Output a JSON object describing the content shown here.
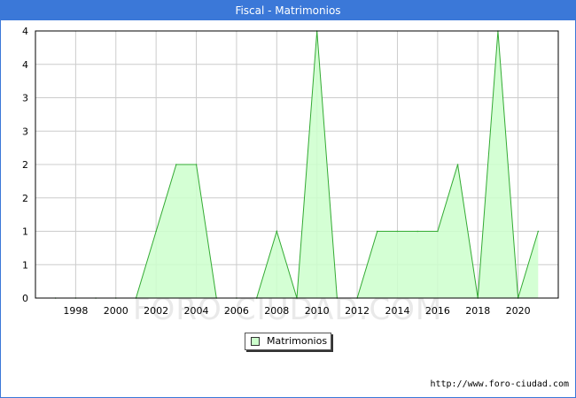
{
  "window": {
    "title": "Fiscal - Matrimonios"
  },
  "watermark": "FORO-CIUDAD.COM",
  "footer_url": "http://www.foro-ciudad.com",
  "colors": {
    "title_bar": "#3b78d8",
    "area_fill": "#ccffcc",
    "area_line": "#33aa33",
    "grid": "#cccccc"
  },
  "chart_data": {
    "type": "area",
    "title": "Fiscal - Matrimonios",
    "xlabel": "",
    "ylabel": "",
    "x": [
      1997,
      1998,
      1999,
      2000,
      2001,
      2002,
      2003,
      2004,
      2005,
      2006,
      2007,
      2008,
      2009,
      2010,
      2011,
      2012,
      2013,
      2014,
      2015,
      2016,
      2017,
      2018,
      2019,
      2020,
      2021
    ],
    "series": [
      {
        "name": "Matrimonios",
        "values": [
          0,
          0,
          0,
          0,
          0,
          1,
          2,
          2,
          0,
          0,
          0,
          1,
          0,
          4,
          0,
          0,
          1,
          1,
          1,
          1,
          2,
          0,
          4,
          0,
          1
        ]
      }
    ],
    "x_ticks": [
      "1998",
      "2000",
      "2002",
      "2004",
      "2006",
      "2008",
      "2010",
      "2012",
      "2014",
      "2016",
      "2018",
      "2020"
    ],
    "y_tick_labels": [
      "0",
      "1",
      "1",
      "2",
      "2",
      "3",
      "3",
      "4",
      "4"
    ],
    "xlim": [
      1996,
      2022
    ],
    "ylim": [
      0,
      4
    ],
    "grid": true,
    "legend": {
      "position": "bottom-center",
      "entries": [
        "Matrimonios"
      ]
    }
  }
}
